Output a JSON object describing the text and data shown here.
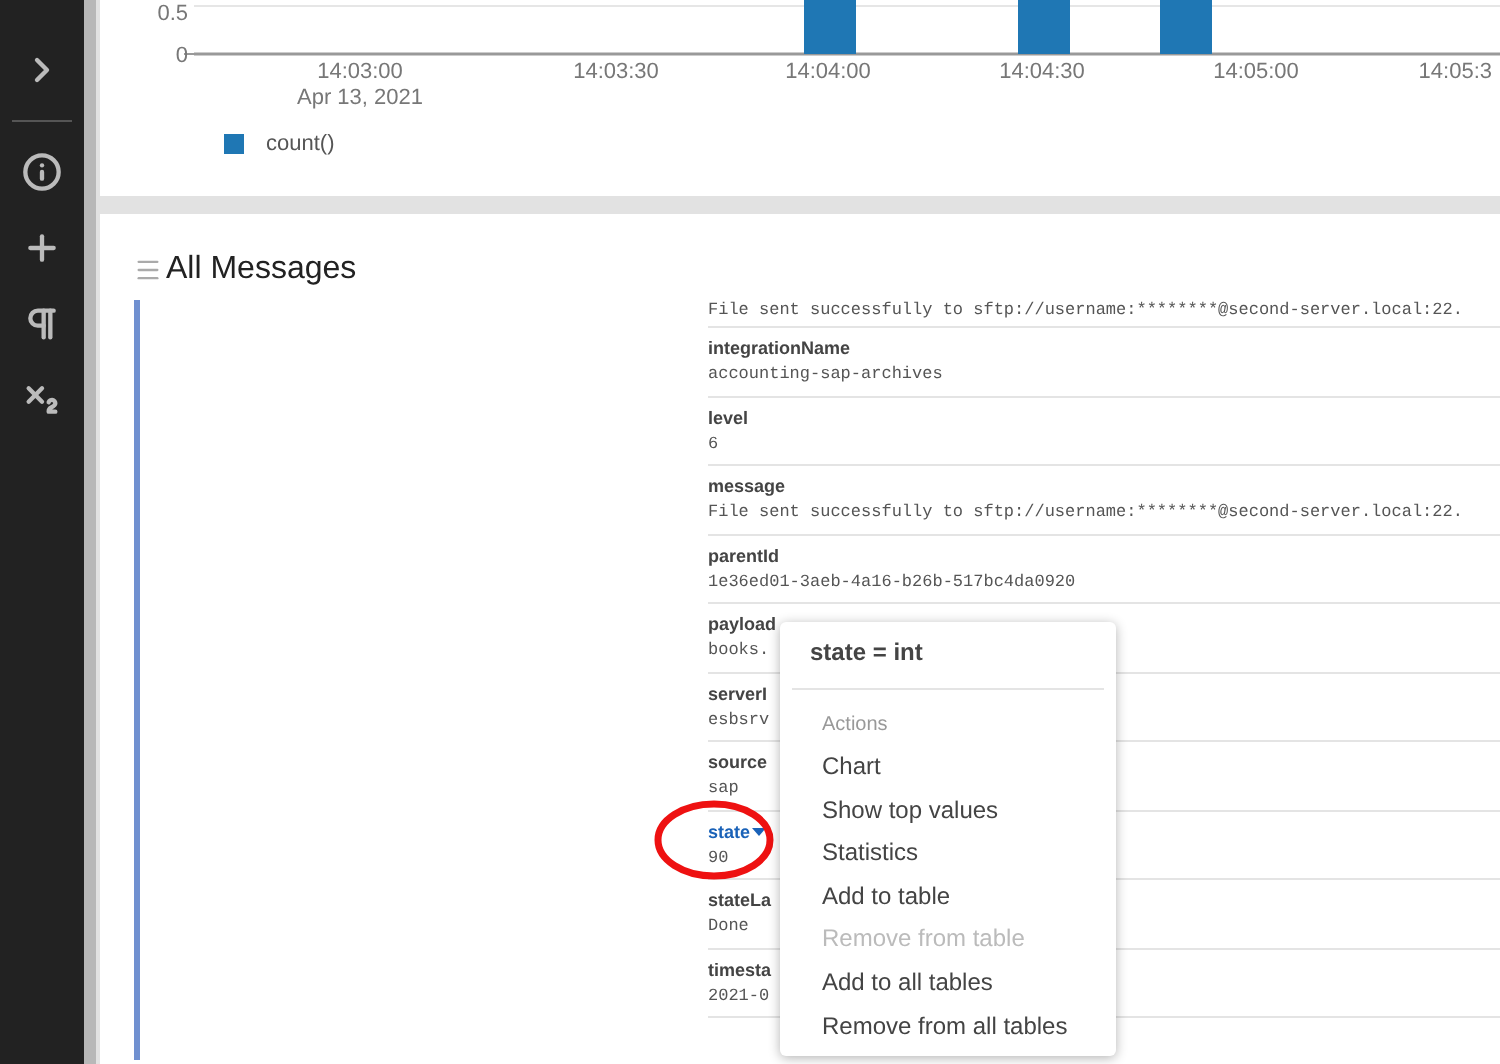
{
  "sidebar": {
    "items": [
      {
        "kind": "chevron"
      },
      {
        "kind": "info"
      },
      {
        "kind": "plus"
      },
      {
        "kind": "pilcrow"
      },
      {
        "kind": "subscript"
      }
    ]
  },
  "chart": {
    "y_ticks": [
      "0.5",
      "0"
    ],
    "x_ticks": [
      "14:03:00",
      "14:03:30",
      "14:04:00",
      "14:04:30",
      "14:05:00",
      "14:05:3"
    ],
    "date_label": "Apr 13, 2021",
    "legend": "count()"
  },
  "messages": {
    "title": "All Messages",
    "fields": [
      {
        "value": "File sent successfully to sftp://username:********@second-server.local:22."
      },
      {
        "name": "integrationName",
        "value": "accounting-sap-archives",
        "active": false
      },
      {
        "name": "level",
        "value": "6",
        "active": false
      },
      {
        "name": "message",
        "value": "File sent successfully to sftp://username:********@second-server.local:22.",
        "active": false
      },
      {
        "name": "parentId",
        "value": "1e36ed01-3aeb-4a16-b26b-517bc4da0920",
        "active": false
      },
      {
        "name": "payload",
        "value": "books.",
        "active": false
      },
      {
        "name": "serverI",
        "value": "esbsrv",
        "active": false
      },
      {
        "name": "source",
        "value": "sap",
        "active": false
      },
      {
        "name": "state",
        "value": "90",
        "active": true
      },
      {
        "name": "stateLa",
        "value": "Done",
        "active": false
      },
      {
        "name": "timesta",
        "value": "2021-0",
        "active": false
      }
    ]
  },
  "popup": {
    "title": "state = int",
    "section": "Actions",
    "items": [
      {
        "label": "Chart",
        "disabled": false
      },
      {
        "label": "Show top values",
        "disabled": false
      },
      {
        "label": "Statistics",
        "disabled": false
      },
      {
        "label": "Add to table",
        "disabled": false
      },
      {
        "label": "Remove from table",
        "disabled": true
      },
      {
        "label": "Add to all tables",
        "disabled": false
      },
      {
        "label": "Remove from all tables",
        "disabled": false
      }
    ]
  }
}
